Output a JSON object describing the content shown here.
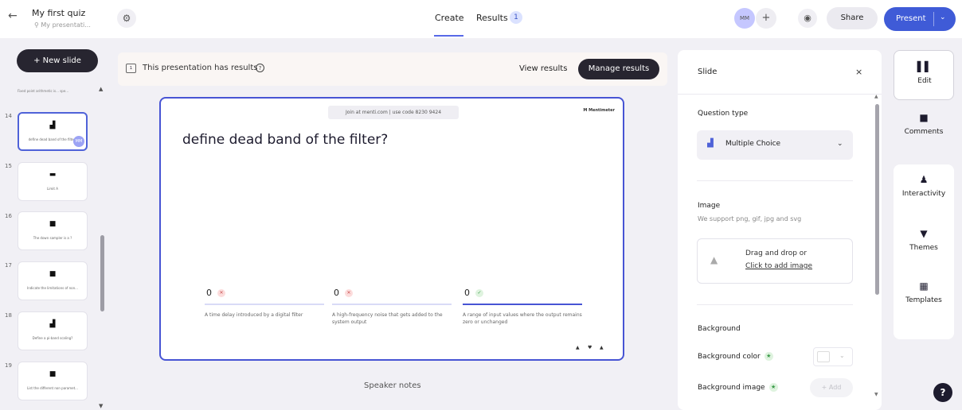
{
  "header": {
    "back_icon": "←",
    "title": "My first quiz",
    "subtitle": "⚲ My presentati...",
    "settings_icon": "⚙",
    "tabs": [
      {
        "label": "Create"
      },
      {
        "label": "Results",
        "badge": "1"
      }
    ],
    "avatar": "MM",
    "add_collaborator": "+",
    "preview_icon": "◉",
    "share_label": "Share",
    "present_label": "Present",
    "present_chevron": "⌄"
  },
  "sidebar": {
    "new_slide_label": "+ New slide",
    "first_slide_text": "Fixed point arithmetic is... spe...",
    "slides": [
      {
        "number": "14",
        "icon": "▟",
        "text": "define dead band of the filter?",
        "selected": true,
        "avatar": "MM"
      },
      {
        "number": "15",
        "icon": "▬",
        "text": "Limit A",
        "selected": false
      },
      {
        "number": "16",
        "icon": "■",
        "text": "The down sampler is a ?",
        "selected": false
      },
      {
        "number": "17",
        "icon": "■",
        "text": "Indicate the limitations of non...",
        "selected": false
      },
      {
        "number": "18",
        "icon": "▟",
        "text": "Define a pi-band scaling?",
        "selected": false
      },
      {
        "number": "19",
        "icon": "■",
        "text": "List the different non paramet...",
        "selected": false
      }
    ],
    "scroll_up": "▲",
    "scroll_down": "▼"
  },
  "results_bar": {
    "icon": "1",
    "text": "This presentation has results",
    "help_icon": "?",
    "view_results": "View results",
    "manage_results": "Manage results"
  },
  "slide": {
    "join_text": "Join at menti.com | use code  8230 9424",
    "brand": "M Mentimeter",
    "question": "define dead band of the filter?",
    "options": [
      {
        "count": "0",
        "mark": "✕",
        "label": "A time delay introduced by a digital filter",
        "correct": false
      },
      {
        "count": "0",
        "mark": "✕",
        "label": "A high-frequency noise that gets added to the system output",
        "correct": false
      },
      {
        "count": "0",
        "mark": "✓",
        "label": "A range of input values where the output remains zero or unchanged",
        "correct": true
      }
    ],
    "reactions": [
      "▲",
      "♥",
      "▲"
    ]
  },
  "speaker_notes": "Speaker notes",
  "panel": {
    "title": "Slide",
    "close_icon": "×",
    "question_type_label": "Question type",
    "question_type_icon": "▟",
    "question_type_value": "Multiple Choice",
    "question_type_chevron": "⌄",
    "image_label": "Image",
    "image_hint": "We support png, gif, jpg and svg",
    "image_icon": "▲",
    "drop_text": "Drag and drop or",
    "drop_link": "Click to add image",
    "background_label": "Background",
    "background_color_label": "Background color",
    "background_image_label": "Background image",
    "star_icon": "★",
    "color_chevron": "⌄",
    "add_label": "+ Add"
  },
  "rail": {
    "items": [
      {
        "icon": "▌▌",
        "label": "Edit"
      },
      {
        "icon": "■",
        "label": "Comments"
      },
      {
        "icon": "♟",
        "label": "Interactivity"
      },
      {
        "icon": "▼",
        "label": "Themes"
      },
      {
        "icon": "▦",
        "label": "Templates"
      }
    ]
  },
  "help_icon": "?"
}
